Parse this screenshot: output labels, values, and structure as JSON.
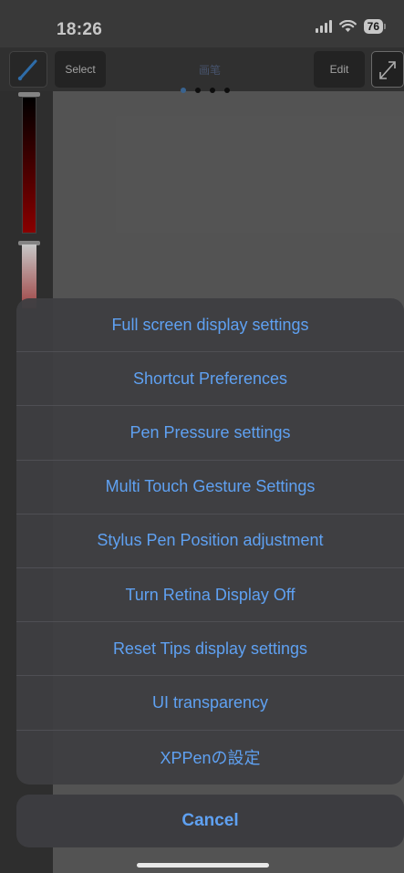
{
  "status_bar": {
    "time": "18:26",
    "battery": "76"
  },
  "toolbar": {
    "select_label": "Select",
    "title": "画笔",
    "edit_label": "Edit",
    "page_count": 4,
    "active_page": 1
  },
  "icons": {
    "brush": "brush-icon",
    "fullscreen": "expand-arrows-icon",
    "signal": "cellular-signal-icon",
    "wifi": "wifi-icon",
    "battery": "battery-icon"
  },
  "action_sheet": {
    "items": [
      "Full screen display settings",
      "Shortcut Preferences",
      "Pen Pressure settings",
      "Multi Touch Gesture Settings",
      "Stylus Pen Position adjustment",
      "Turn Retina Display Off",
      "Reset Tips display settings",
      "UI transparency",
      "XPPenの設定"
    ],
    "cancel_label": "Cancel"
  },
  "colors": {
    "accent": "#5fa1f2",
    "sheet_bg": "#3e3e42",
    "status_bar_bg": "#4a4a4a",
    "color_slider_bottom": "#b00000"
  }
}
